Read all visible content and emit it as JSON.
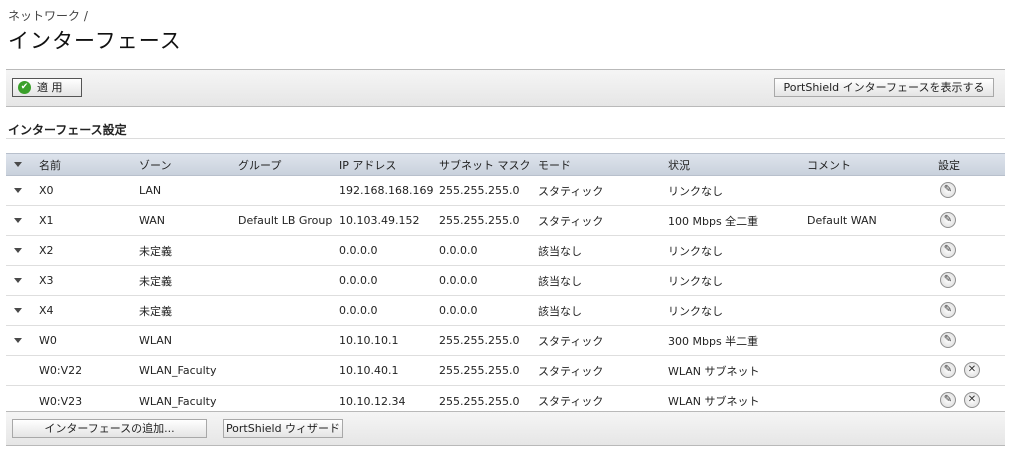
{
  "breadcrumb": "ネットワーク /",
  "page_title": "インターフェース",
  "toolbar": {
    "apply_label": "適 用",
    "portshield_label": "PortShield インターフェースを表示する"
  },
  "section_title": "インターフェース設定",
  "table": {
    "headers": [
      "名前",
      "ゾーン",
      "グループ",
      "IP アドレス",
      "サブネット マスク",
      "モード",
      "状況",
      "コメント",
      "設定"
    ],
    "rows": [
      {
        "name": "X0",
        "zone": "LAN",
        "group": "",
        "ip": "192.168.168.169",
        "mask": "255.255.255.0",
        "mode": "スタティック",
        "status": "リンクなし",
        "comment": "",
        "expandable": true,
        "deletable": false
      },
      {
        "name": "X1",
        "zone": "WAN",
        "group": "Default LB Group",
        "ip": "10.103.49.152",
        "mask": "255.255.255.0",
        "mode": "スタティック",
        "status": "100 Mbps 全二重",
        "comment": "Default WAN",
        "expandable": true,
        "deletable": false
      },
      {
        "name": "X2",
        "zone": "未定義",
        "group": "",
        "ip": "0.0.0.0",
        "mask": "0.0.0.0",
        "mode": "該当なし",
        "status": "リンクなし",
        "comment": "",
        "expandable": true,
        "deletable": false
      },
      {
        "name": "X3",
        "zone": "未定義",
        "group": "",
        "ip": "0.0.0.0",
        "mask": "0.0.0.0",
        "mode": "該当なし",
        "status": "リンクなし",
        "comment": "",
        "expandable": true,
        "deletable": false
      },
      {
        "name": "X4",
        "zone": "未定義",
        "group": "",
        "ip": "0.0.0.0",
        "mask": "0.0.0.0",
        "mode": "該当なし",
        "status": "リンクなし",
        "comment": "",
        "expandable": true,
        "deletable": false
      },
      {
        "name": "W0",
        "zone": "WLAN",
        "group": "",
        "ip": "10.10.10.1",
        "mask": "255.255.255.0",
        "mode": "スタティック",
        "status": "300 Mbps 半二重",
        "comment": "",
        "expandable": true,
        "deletable": false
      },
      {
        "name": "W0:V22",
        "zone": "WLAN_Faculty",
        "group": "",
        "ip": "10.10.40.1",
        "mask": "255.255.255.0",
        "mode": "スタティック",
        "status": "WLAN サブネット",
        "comment": "",
        "expandable": false,
        "deletable": true
      },
      {
        "name": "W0:V23",
        "zone": "WLAN_Faculty",
        "group": "",
        "ip": "10.10.12.34",
        "mask": "255.255.255.0",
        "mode": "スタティック",
        "status": "WLAN サブネット",
        "comment": "",
        "expandable": false,
        "deletable": true
      }
    ]
  },
  "bottom": {
    "add_label": "インターフェースの追加...",
    "wizard_label": "PortShield ウィザード"
  },
  "icons": {
    "apply": "checkmark-icon",
    "edit": "pencil-icon",
    "delete": "close-icon",
    "expand": "triangle-down-icon"
  }
}
